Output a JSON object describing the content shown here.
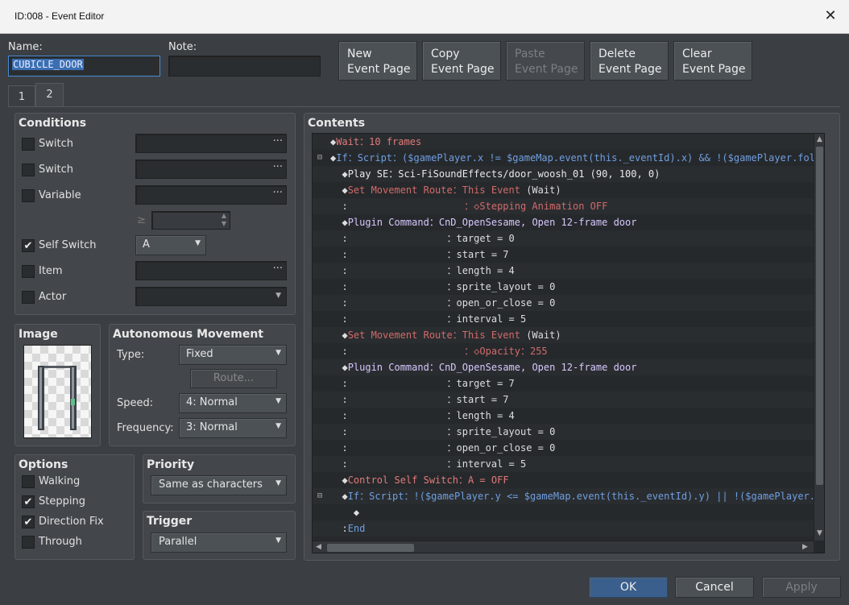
{
  "window": {
    "title": "ID:008 - Event Editor",
    "close_glyph": "✕"
  },
  "name": {
    "label": "Name:",
    "value": "CUBICLE_DOOR"
  },
  "note": {
    "label": "Note:",
    "value": ""
  },
  "toolbar": {
    "new": [
      "New",
      "Event Page"
    ],
    "copy": [
      "Copy",
      "Event Page"
    ],
    "paste": [
      "Paste",
      "Event Page"
    ],
    "delete": [
      "Delete",
      "Event Page"
    ],
    "clear": [
      "Clear",
      "Event Page"
    ]
  },
  "tabs": [
    "1",
    "2"
  ],
  "conditions": {
    "title": "Conditions",
    "switch1": "Switch",
    "switch2": "Switch",
    "variable": "Variable",
    "ge": "≥",
    "self_switch": "Self Switch",
    "self_switch_value": "A",
    "item": "Item",
    "actor": "Actor",
    "dots": "···"
  },
  "image": {
    "title": "Image"
  },
  "autonomous": {
    "title": "Autonomous Movement",
    "type_label": "Type:",
    "type_value": "Fixed",
    "route_label": "Route...",
    "speed_label": "Speed:",
    "speed_value": "4: Normal",
    "freq_label": "Frequency:",
    "freq_value": "3: Normal"
  },
  "options": {
    "title": "Options",
    "walking": "Walking",
    "stepping": "Stepping",
    "direction_fix": "Direction Fix",
    "through": "Through",
    "checked": {
      "walking": false,
      "stepping": true,
      "direction_fix": true,
      "through": false
    }
  },
  "priority": {
    "title": "Priority",
    "value": "Same as characters"
  },
  "trigger": {
    "title": "Trigger",
    "value": "Parallel"
  },
  "contents": {
    "title": "Contents",
    "rows": [
      {
        "fold": "",
        "parts": [
          {
            "t": "◆",
            "c": "#dddddd"
          },
          {
            "t": "Wait",
            "c": "#e27a7a"
          },
          {
            "t": "：10 frames",
            "c": "#e27a7a"
          }
        ]
      },
      {
        "fold": "⊟",
        "parts": [
          {
            "t": "◆",
            "c": "#dddddd"
          },
          {
            "t": "If",
            "c": "#6f9fe0"
          },
          {
            "t": "：Script：($gamePlayer.x != $gameMap.event(this._eventId).x) && !($gamePlayer.foll",
            "c": "#6f9fe0"
          }
        ]
      },
      {
        "fold": "",
        "parts": [
          {
            "t": "  ◆",
            "c": "#dddddd"
          },
          {
            "t": "Play SE",
            "c": "#e8e8e8"
          },
          {
            "t": "：Sci-FiSoundEffects/door_woosh_01 (90, 100, 0)",
            "c": "#e8e8e8"
          }
        ]
      },
      {
        "fold": "",
        "parts": [
          {
            "t": "  ◆",
            "c": "#dddddd"
          },
          {
            "t": "Set Movement Route",
            "c": "#d26a6a"
          },
          {
            "t": "：This Event",
            "c": "#d26a6a"
          },
          {
            "t": " (Wait)",
            "c": "#dddddd"
          }
        ]
      },
      {
        "fold": "",
        "parts": [
          {
            "t": "  :",
            "c": "#dddddd"
          },
          {
            "t": "                    ：◇Stepping Animation OFF",
            "c": "#d26a6a"
          }
        ]
      },
      {
        "fold": "",
        "parts": [
          {
            "t": "  ◆",
            "c": "#dddddd"
          },
          {
            "t": "Plugin Command",
            "c": "#d8c8ff"
          },
          {
            "t": "：CnD_OpenSesame, Open 12-frame door",
            "c": "#d8c8ff"
          }
        ]
      },
      {
        "fold": "",
        "parts": [
          {
            "t": "  :",
            "c": "#dddddd"
          },
          {
            "t": "                 ：target = 0",
            "c": "#dddddd"
          }
        ]
      },
      {
        "fold": "",
        "parts": [
          {
            "t": "  :",
            "c": "#dddddd"
          },
          {
            "t": "                 ：start = 7",
            "c": "#dddddd"
          }
        ]
      },
      {
        "fold": "",
        "parts": [
          {
            "t": "  :",
            "c": "#dddddd"
          },
          {
            "t": "                 ：length = 4",
            "c": "#dddddd"
          }
        ]
      },
      {
        "fold": "",
        "parts": [
          {
            "t": "  :",
            "c": "#dddddd"
          },
          {
            "t": "                 ：sprite_layout = 0",
            "c": "#dddddd"
          }
        ]
      },
      {
        "fold": "",
        "parts": [
          {
            "t": "  :",
            "c": "#dddddd"
          },
          {
            "t": "                 ：open_or_close = 0",
            "c": "#dddddd"
          }
        ]
      },
      {
        "fold": "",
        "parts": [
          {
            "t": "  :",
            "c": "#dddddd"
          },
          {
            "t": "                 ：interval = 5",
            "c": "#dddddd"
          }
        ]
      },
      {
        "fold": "",
        "parts": [
          {
            "t": "  ◆",
            "c": "#dddddd"
          },
          {
            "t": "Set Movement Route",
            "c": "#d26a6a"
          },
          {
            "t": "：This Event",
            "c": "#d26a6a"
          },
          {
            "t": " (Wait)",
            "c": "#dddddd"
          }
        ]
      },
      {
        "fold": "",
        "parts": [
          {
            "t": "  :",
            "c": "#dddddd"
          },
          {
            "t": "                    ：◇Opacity：255",
            "c": "#d26a6a"
          }
        ]
      },
      {
        "fold": "",
        "parts": [
          {
            "t": "  ◆",
            "c": "#dddddd"
          },
          {
            "t": "Plugin Command",
            "c": "#d8c8ff"
          },
          {
            "t": "：CnD_OpenSesame, Open 12-frame door",
            "c": "#d8c8ff"
          }
        ]
      },
      {
        "fold": "",
        "parts": [
          {
            "t": "  :",
            "c": "#dddddd"
          },
          {
            "t": "                 ：target = 7",
            "c": "#dddddd"
          }
        ]
      },
      {
        "fold": "",
        "parts": [
          {
            "t": "  :",
            "c": "#dddddd"
          },
          {
            "t": "                 ：start = 7",
            "c": "#dddddd"
          }
        ]
      },
      {
        "fold": "",
        "parts": [
          {
            "t": "  :",
            "c": "#dddddd"
          },
          {
            "t": "                 ：length = 4",
            "c": "#dddddd"
          }
        ]
      },
      {
        "fold": "",
        "parts": [
          {
            "t": "  :",
            "c": "#dddddd"
          },
          {
            "t": "                 ：sprite_layout = 0",
            "c": "#dddddd"
          }
        ]
      },
      {
        "fold": "",
        "parts": [
          {
            "t": "  :",
            "c": "#dddddd"
          },
          {
            "t": "                 ：open_or_close = 0",
            "c": "#dddddd"
          }
        ]
      },
      {
        "fold": "",
        "parts": [
          {
            "t": "  :",
            "c": "#dddddd"
          },
          {
            "t": "                 ：interval = 5",
            "c": "#dddddd"
          }
        ]
      },
      {
        "fold": "",
        "parts": [
          {
            "t": "  ◆",
            "c": "#dddddd"
          },
          {
            "t": "Control Self Switch",
            "c": "#e27a7a"
          },
          {
            "t": "：A = OFF",
            "c": "#e27a7a"
          }
        ]
      },
      {
        "fold": "⊟",
        "parts": [
          {
            "t": "  ◆",
            "c": "#dddddd"
          },
          {
            "t": "If",
            "c": "#6f9fe0"
          },
          {
            "t": "：Script：!($gamePlayer.y <= $gameMap.event(this._eventId).y) || !($gamePlayer.f",
            "c": "#6f9fe0"
          }
        ]
      },
      {
        "fold": "",
        "parts": [
          {
            "t": "    ◆",
            "c": "#dddddd"
          }
        ]
      },
      {
        "fold": "",
        "parts": [
          {
            "t": "  :",
            "c": "#dddddd"
          },
          {
            "t": "End",
            "c": "#6f9fe0"
          }
        ]
      }
    ]
  },
  "footer": {
    "ok": "OK",
    "cancel": "Cancel",
    "apply": "Apply"
  }
}
